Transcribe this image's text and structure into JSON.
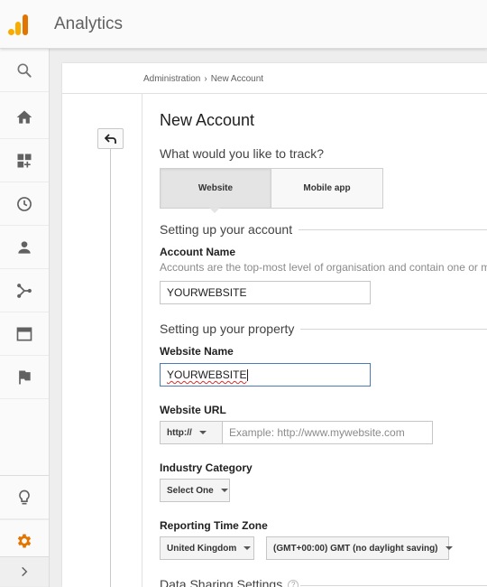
{
  "app": {
    "title": "Analytics"
  },
  "rail": {
    "items": [
      {
        "icon": "search-icon"
      },
      {
        "icon": "home-icon"
      },
      {
        "icon": "customization-icon"
      },
      {
        "icon": "realtime-clock-icon"
      },
      {
        "icon": "audience-person-icon"
      },
      {
        "icon": "acquisition-icon"
      },
      {
        "icon": "behavior-icon"
      },
      {
        "icon": "conversions-flag-icon"
      }
    ],
    "bottom": [
      {
        "icon": "lightbulb-icon"
      },
      {
        "icon": "admin-gear-icon",
        "color": "#e37400"
      },
      {
        "icon": "expand-chevron-icon"
      }
    ]
  },
  "breadcrumb": {
    "root": "Administration",
    "separator": "›",
    "current": "New Account"
  },
  "form": {
    "title": "New Account",
    "track_question": "What would you like to track?",
    "track_options": [
      {
        "label": "Website",
        "selected": true
      },
      {
        "label": "Mobile app",
        "selected": false
      }
    ],
    "account_section": {
      "title": "Setting up your account",
      "name_label": "Account Name",
      "name_help": "Accounts are the top-most level of organisation and contain one or more tracking IDs.",
      "name_value": "YOURWEBSITE"
    },
    "property_section": {
      "title": "Setting up your property",
      "website_name_label": "Website Name",
      "website_name_value": "YOURWEBSITE",
      "website_url_label": "Website URL",
      "protocol_value": "http://",
      "url_placeholder": "Example: http://www.mywebsite.com",
      "industry_label": "Industry Category",
      "industry_value": "Select One",
      "timezone_label": "Reporting Time Zone",
      "timezone_country": "United Kingdom",
      "timezone_value": "(GMT+00:00) GMT (no daylight saving)"
    },
    "data_sharing": {
      "title": "Data Sharing Settings",
      "help_glyph": "?"
    }
  },
  "colors": {
    "accent_orange": "#e37400",
    "logo_yellow": "#f9ab00",
    "focus_blue": "#4a7bb8"
  }
}
